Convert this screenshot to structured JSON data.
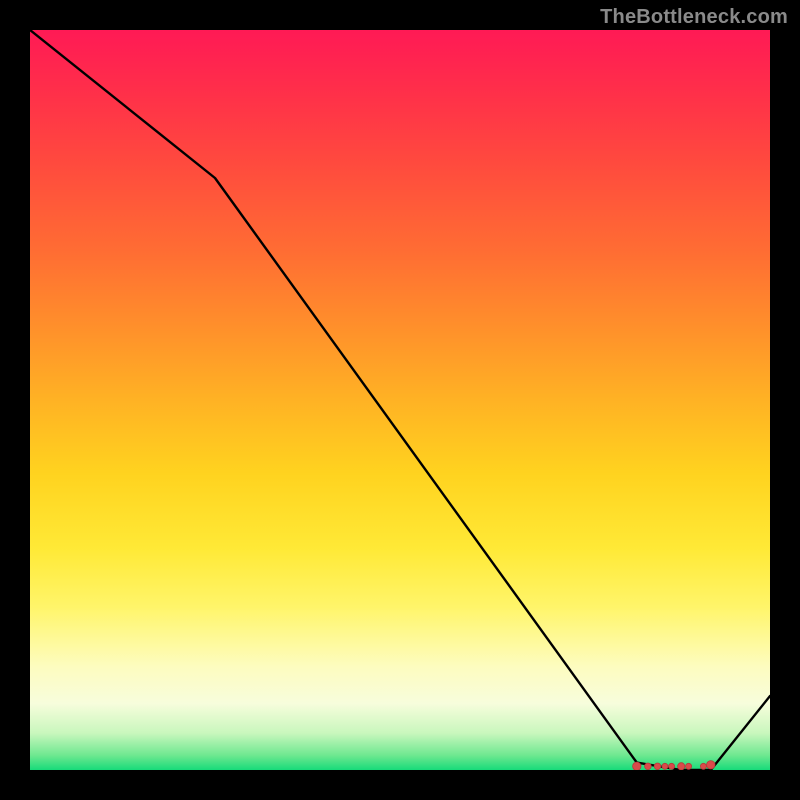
{
  "attribution": "TheBottleneck.com",
  "colors": {
    "line": "#000000",
    "marker_fill": "#d94a4a",
    "marker_stroke": "#b63b3b",
    "background_black": "#000000"
  },
  "chart_data": {
    "type": "line",
    "title": "",
    "xlabel": "",
    "ylabel": "",
    "xlim": [
      0,
      100
    ],
    "ylim": [
      0,
      100
    ],
    "x": [
      0,
      25,
      82,
      88,
      92,
      100
    ],
    "values": [
      100,
      80,
      1,
      0,
      0,
      10
    ],
    "markers_x": [
      82,
      83.5,
      84.8,
      85.8,
      86.7,
      88.0,
      89.0,
      91.0,
      92.0
    ],
    "markers_y": [
      0.5,
      0.5,
      0.5,
      0.5,
      0.5,
      0.5,
      0.5,
      0.5,
      0.7
    ],
    "marker_radii": [
      4.2,
      3.3,
      3.3,
      3.0,
      3.0,
      3.6,
      3.0,
      3.0,
      4.2
    ]
  }
}
